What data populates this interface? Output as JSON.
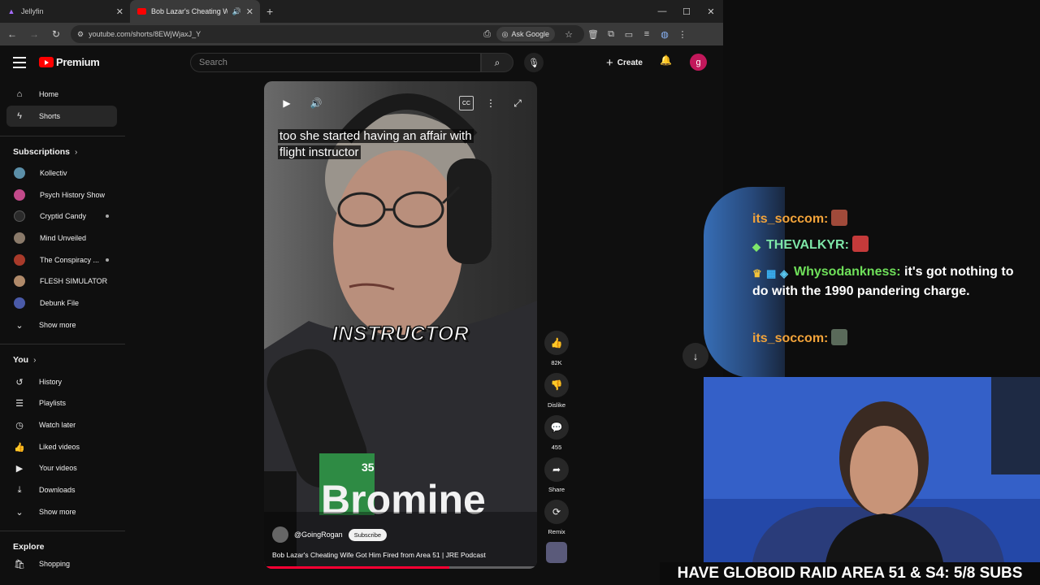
{
  "browser": {
    "tabs": [
      {
        "title": "Jellyfin",
        "icon": "jellyfin-icon"
      },
      {
        "title": "Bob Lazar's Cheating Wife G",
        "icon": "youtube-icon"
      }
    ],
    "url": "youtube.com/shorts/8EWjWjaxJ_Y",
    "ask_google": "Ask Google"
  },
  "youtube": {
    "logo_text": "Premium",
    "search_placeholder": "Search",
    "create_label": "Create",
    "avatar_letter": "g",
    "sidebar": {
      "main": [
        {
          "label": "Home",
          "icon": "home-icon"
        },
        {
          "label": "Shorts",
          "icon": "shorts-icon",
          "active": true
        }
      ],
      "subscriptions_heading": "Subscriptions",
      "subscriptions": [
        {
          "label": "Kollectiv",
          "color": "#5b8fa8"
        },
        {
          "label": "Psych History Show",
          "color": "#c24a8a"
        },
        {
          "label": "Cryptid Candy",
          "color": "#2b2b2b",
          "new": true
        },
        {
          "label": "Mind Unveiled",
          "color": "#8a7a6a"
        },
        {
          "label": "The Conspiracy ...",
          "color": "#a83a2a",
          "new": true
        },
        {
          "label": "FLESH SIMULATOR",
          "color": "#b08a6a"
        },
        {
          "label": "Debunk File",
          "color": "#4a5aa8"
        }
      ],
      "show_more": "Show more",
      "you_heading": "You",
      "you_items": [
        {
          "label": "History",
          "icon": "history-icon"
        },
        {
          "label": "Playlists",
          "icon": "playlists-icon"
        },
        {
          "label": "Watch later",
          "icon": "watch-later-icon"
        },
        {
          "label": "Liked videos",
          "icon": "like-icon"
        },
        {
          "label": "Your videos",
          "icon": "your-videos-icon"
        },
        {
          "label": "Downloads",
          "icon": "download-icon"
        }
      ],
      "show_more_2": "Show more",
      "explore_heading": "Explore",
      "explore_items": [
        {
          "label": "Shopping",
          "icon": "shopping-icon"
        }
      ]
    },
    "short": {
      "caption": "too she started having an affair with flight instructor",
      "caption_line1": "too she started having an affair with",
      "caption_line2": "flight instructor",
      "overlay_word": "INSTRUCTOR",
      "shirt_number": "35",
      "shirt_text": "Bromine",
      "channel": "@GoingRogan",
      "subscribe": "Subscribe",
      "title": "Bob Lazar's Cheating Wife Got Him Fired from Area 51 | JRE Podcast",
      "progress": 0.68
    },
    "actions": [
      {
        "label": "82K",
        "icon": "thumbs-up-icon"
      },
      {
        "label": "Dislike",
        "icon": "thumbs-down-icon"
      },
      {
        "label": "455",
        "icon": "comment-icon"
      },
      {
        "label": "Share",
        "icon": "share-icon"
      },
      {
        "label": "Remix",
        "icon": "remix-icon"
      }
    ]
  },
  "stream": {
    "chat": [
      {
        "user": "its_soccom:",
        "color": "#f2a33a",
        "text": "",
        "badges": []
      },
      {
        "user": "THEVALKYR:",
        "color": "#7ee6a8",
        "text": "",
        "badges": [
          "diamond-badge"
        ]
      },
      {
        "user": "Whysodankness:",
        "color": "#6fe05a",
        "text": "it's got nothing to do with the 1990 pandering charge.",
        "badges": [
          "crown-badge",
          "game-badge",
          "cube-badge"
        ]
      },
      {
        "user": "its_soccom:",
        "color": "#f2a33a",
        "text": "",
        "badges": []
      }
    ],
    "ticker": "HAVE GLOBOID RAID AREA 51 & S4: 5/8 SUBS"
  }
}
